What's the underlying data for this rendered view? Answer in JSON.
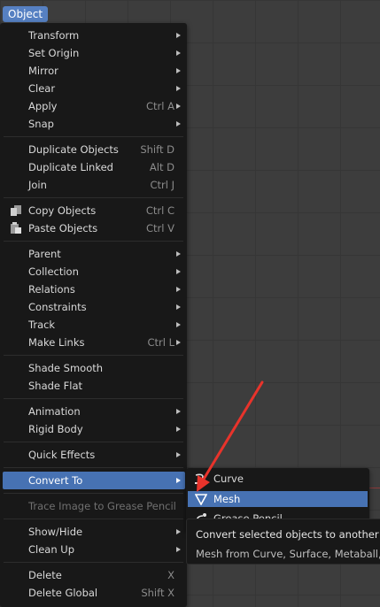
{
  "menu_header": {
    "label": "Object"
  },
  "object_menu": {
    "items": [
      {
        "label": "Transform",
        "submenu": true
      },
      {
        "label": "Set Origin",
        "submenu": true
      },
      {
        "label": "Mirror",
        "submenu": true
      },
      {
        "label": "Clear",
        "submenu": true
      },
      {
        "label": "Apply",
        "shortcut": "Ctrl A",
        "submenu": true
      },
      {
        "label": "Snap",
        "submenu": true
      },
      {
        "label": "Duplicate Objects",
        "shortcut": "Shift D"
      },
      {
        "label": "Duplicate Linked",
        "shortcut": "Alt D"
      },
      {
        "label": "Join",
        "shortcut": "Ctrl J"
      },
      {
        "label": "Copy Objects",
        "shortcut": "Ctrl C",
        "icon": "copy-icon"
      },
      {
        "label": "Paste Objects",
        "shortcut": "Ctrl V",
        "icon": "paste-icon"
      },
      {
        "label": "Parent",
        "submenu": true
      },
      {
        "label": "Collection",
        "submenu": true
      },
      {
        "label": "Relations",
        "submenu": true
      },
      {
        "label": "Constraints",
        "submenu": true
      },
      {
        "label": "Track",
        "submenu": true
      },
      {
        "label": "Make Links",
        "shortcut": "Ctrl L",
        "submenu": true
      },
      {
        "label": "Shade Smooth"
      },
      {
        "label": "Shade Flat"
      },
      {
        "label": "Animation",
        "submenu": true
      },
      {
        "label": "Rigid Body",
        "submenu": true
      },
      {
        "label": "Quick Effects",
        "submenu": true
      },
      {
        "label": "Convert To",
        "submenu": true,
        "state": "active"
      },
      {
        "label": "Trace Image to Grease Pencil",
        "state": "disabled"
      },
      {
        "label": "Show/Hide",
        "submenu": true
      },
      {
        "label": "Clean Up",
        "submenu": true
      },
      {
        "label": "Delete",
        "shortcut": "X"
      },
      {
        "label": "Delete Global",
        "shortcut": "Shift X"
      }
    ]
  },
  "convert_submenu": {
    "items": [
      {
        "label": "Curve",
        "icon": "curve-icon"
      },
      {
        "label": "Mesh",
        "icon": "mesh-icon",
        "state": "highlighted"
      },
      {
        "label": "Grease Pencil",
        "icon": "grease-pencil-icon"
      }
    ]
  },
  "tooltip": {
    "title": "Convert selected objects to another type:",
    "description": "Mesh from Curve, Surface, Metaball, or Text objects"
  },
  "annotation": {
    "color": "#e8332b",
    "icon": "red-arrow-icon"
  },
  "colors": {
    "menu_bg": "#181818",
    "highlight": "#4772b3",
    "header": "#5680c2"
  }
}
